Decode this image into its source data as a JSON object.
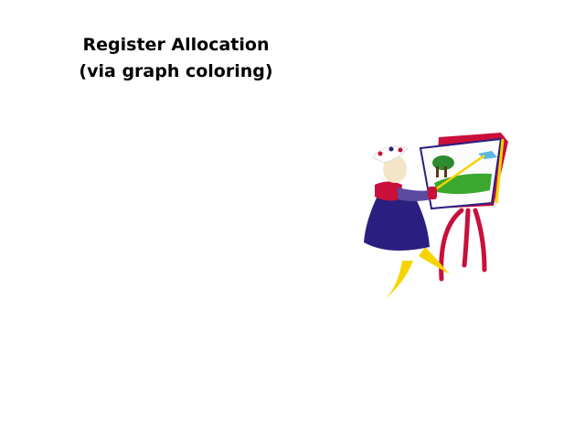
{
  "slide": {
    "title_line1": "Register Allocation",
    "title_line2": "(via graph coloring)",
    "clipart": "painter-at-easel"
  }
}
